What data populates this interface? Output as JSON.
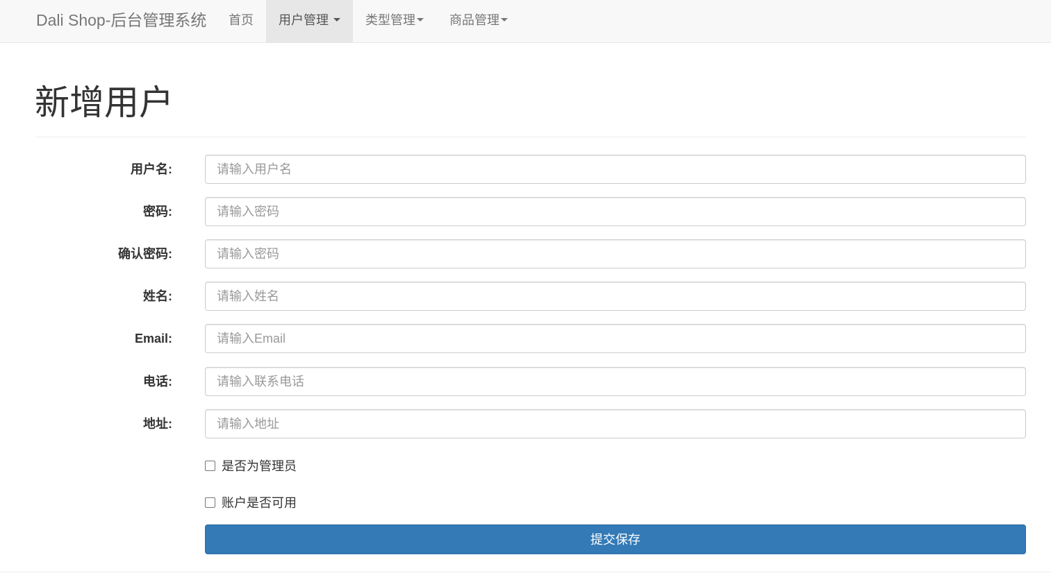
{
  "navbar": {
    "brand": "Dali Shop-后台管理系统",
    "items": [
      {
        "label": "首页",
        "active": false,
        "dropdown": false
      },
      {
        "label": "用户管理",
        "active": true,
        "dropdown": true
      },
      {
        "label": "类型管理",
        "active": false,
        "dropdown": true
      },
      {
        "label": "商品管理",
        "active": false,
        "dropdown": true
      }
    ]
  },
  "page": {
    "title": "新增用户"
  },
  "form": {
    "fields": [
      {
        "label": "用户名:",
        "placeholder": "请输入用户名",
        "value": ""
      },
      {
        "label": "密码:",
        "placeholder": "请输入密码",
        "value": ""
      },
      {
        "label": "确认密码:",
        "placeholder": "请输入密码",
        "value": ""
      },
      {
        "label": "姓名:",
        "placeholder": "请输入姓名",
        "value": ""
      },
      {
        "label": "Email:",
        "placeholder": "请输入Email",
        "value": ""
      },
      {
        "label": "电话:",
        "placeholder": "请输入联系电话",
        "value": ""
      },
      {
        "label": "地址:",
        "placeholder": "请输入地址",
        "value": ""
      }
    ],
    "checkboxes": [
      {
        "label": "是否为管理员",
        "checked": false
      },
      {
        "label": "账户是否可用",
        "checked": false
      }
    ],
    "submit_label": "提交保存"
  },
  "colors": {
    "navbar_bg": "#f8f8f8",
    "active_tab_bg": "#e7e7e7",
    "primary": "#337ab7"
  }
}
